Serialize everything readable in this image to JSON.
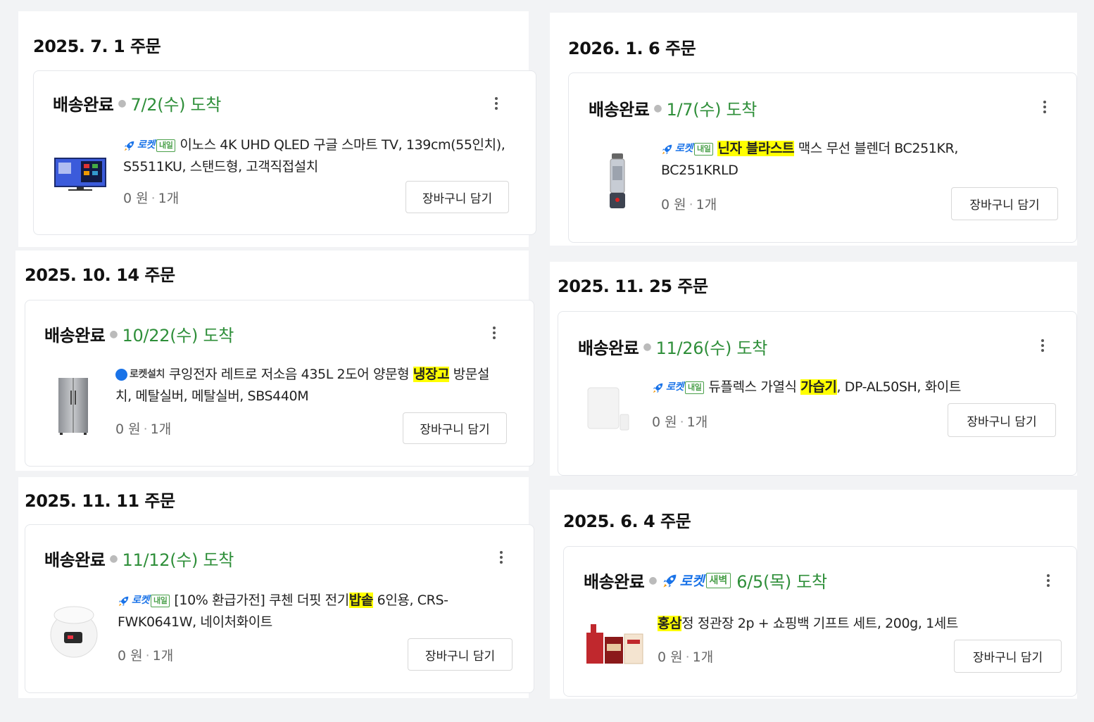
{
  "colors": {
    "arrival_green": "#2f8f3a",
    "highlight": "#ffff00",
    "rocket_blue": "#1a73e8"
  },
  "orders": [
    {
      "date": "2025. 7. 1 주문",
      "status": "배송완료",
      "arrival": "7/2(수) 도착",
      "badge": {
        "type": "rocket",
        "label": "로켓",
        "box": "내일"
      },
      "desc_parts": [
        "이노스 4K UHD QLED 구글 스마트 TV, 139cm(55인치), S5511KU, 스탠드형, 고객직접설치"
      ],
      "price": "0 원",
      "qty": "1개",
      "cart_label": "장바구니 담기",
      "thumb_icon": "tv-icon"
    },
    {
      "date": "2025. 10. 14 주문",
      "status": "배송완료",
      "arrival": "10/22(수) 도착",
      "badge": {
        "type": "install",
        "label": "로켓설치"
      },
      "desc_parts": [
        "쿠잉전자 레트로 저소음 435L 2도어 양문형 ",
        "냉장고",
        " 방문설치, 메탈실버, 메탈실버, SBS440M"
      ],
      "price": "0 원",
      "qty": "1개",
      "cart_label": "장바구니 담기",
      "thumb_icon": "refrigerator-icon"
    },
    {
      "date": "2025. 11. 11 주문",
      "status": "배송완료",
      "arrival": "11/12(수) 도착",
      "badge": {
        "type": "rocket",
        "label": "로켓",
        "box": "내일"
      },
      "desc_parts": [
        "[10% 환급가전] 쿠첸 더핏 전기",
        "밥솥",
        " 6인용, CRS-FWK0641W, 네이처화이트"
      ],
      "price": "0 원",
      "qty": "1개",
      "cart_label": "장바구니 담기",
      "thumb_icon": "rice-cooker-icon"
    },
    {
      "date": "2026. 1. 6 주문",
      "status": "배송완료",
      "arrival": "1/7(수) 도착",
      "badge": {
        "type": "rocket",
        "label": "로켓",
        "box": "내일"
      },
      "desc_parts": [
        "",
        "닌자 블라스트",
        " 맥스 무선 블렌더 BC251KR, BC251KRLD"
      ],
      "price": "0 원",
      "qty": "1개",
      "cart_label": "장바구니 담기",
      "thumb_icon": "blender-icon"
    },
    {
      "date": "2025. 11. 25 주문",
      "status": "배송완료",
      "arrival": "11/26(수) 도착",
      "badge": {
        "type": "rocket",
        "label": "로켓",
        "box": "내일"
      },
      "desc_parts": [
        "듀플렉스 가열식 ",
        "가습기",
        ", DP-AL50SH, 화이트"
      ],
      "price": "0 원",
      "qty": "1개",
      "cart_label": "장바구니 담기",
      "thumb_icon": "humidifier-icon"
    },
    {
      "date": "2025. 6. 4 주문",
      "status": "배송완료",
      "arrival": "6/5(목) 도착",
      "status_badge": {
        "label": "로켓",
        "box": "새벽"
      },
      "desc_parts": [
        "",
        "홍삼",
        "정 정관장 2p + 쇼핑백 기프트 세트, 200g, 1세트"
      ],
      "price": "0 원",
      "qty": "1개",
      "cart_label": "장바구니 담기",
      "thumb_icon": "red-ginseng-gift-set-icon"
    }
  ]
}
